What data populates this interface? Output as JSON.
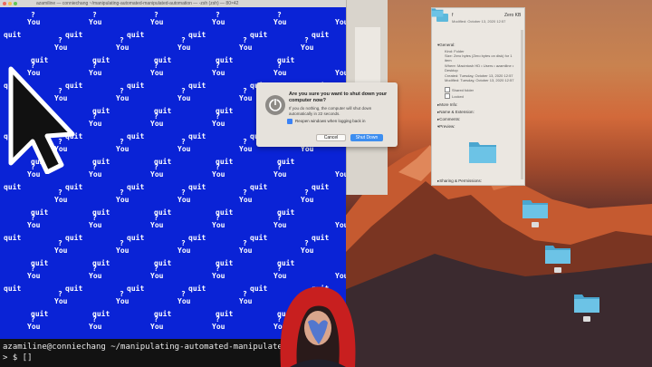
{
  "terminal": {
    "title": "azamiline — conniechang ~/manipulating-automated-manipulated-automation — -zsh (zsh) — 80×42",
    "prompt_line": "azamiline@conniechang ~/manipulating-automated-manipulated-automatio",
    "prompt_symbol": "> $ []",
    "bg_color": "#0a23d6",
    "text_words": {
      "question": "?",
      "you": "You",
      "quit": "quit"
    }
  },
  "dialog": {
    "title": "Are you sure you want to shut down your computer now?",
    "message": "If you do nothing, the computer will shut down automatically in 22 seconds.",
    "reopen_label": "Reopen windows when logging back in",
    "cancel_label": "Cancel",
    "shutdown_label": "Shut Down",
    "accent_color": "#3d8ef0"
  },
  "info_panel": {
    "name": "f",
    "size": "Zero KB",
    "modified": "Modified: October 13, 2020 12:57",
    "general_label": "General:",
    "kind": "Kind: Folder",
    "size_line": "Size: Zero bytes (Zero bytes on disk) for 1 item",
    "where": "Where: Macintosh HD • Users • azamiline • Desktop",
    "created": "Created: Tuesday, October 13, 2020 12:57",
    "modified_line": "Modified: Tuesday, October 13, 2020 12:57",
    "shared_folder": "Shared folder",
    "locked": "Locked",
    "more_info": "More Info:",
    "name_extension": "Name & Extension:",
    "comments": "Comments:",
    "preview": "Preview:",
    "sharing": "Sharing & Permissions:",
    "folder_color": "#5cb8db"
  },
  "desktop": {
    "folder_count": 4
  }
}
